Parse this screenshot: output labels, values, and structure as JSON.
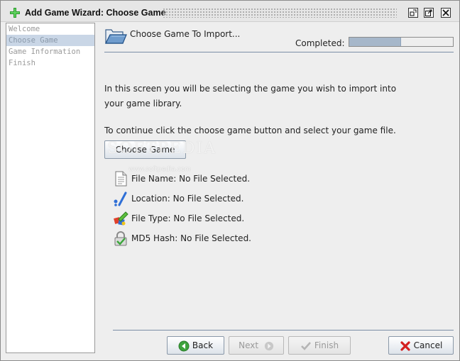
{
  "window": {
    "title": "Add Game Wizard: Choose Game",
    "controls": [
      "restore-icon",
      "maximize-icon",
      "close-icon"
    ]
  },
  "sidebar": {
    "steps": [
      {
        "label": "Welcome",
        "active": false
      },
      {
        "label": "Choose Game",
        "active": true
      },
      {
        "label": "Game Information",
        "active": false
      },
      {
        "label": "Finish",
        "active": false
      }
    ]
  },
  "header": {
    "title": "Choose Game To Import...",
    "completed_label": "Completed:",
    "progress_fraction": 0.5
  },
  "content": {
    "intro": "In this screen you will be selecting the game you wish to import into your game library.",
    "instruction": "To continue click the choose game button and select your game file.",
    "choose_button": "Choose Game",
    "watermark": "SOFTPEDIA",
    "watermark_url": "www.softpedia.com",
    "info": [
      {
        "label": "File Name:  No File Selected.",
        "icon": "file-icon"
      },
      {
        "label": "Location:  No File Selected.",
        "icon": "location-icon"
      },
      {
        "label": "File Type:  No File Selected.",
        "icon": "file-type-icon"
      },
      {
        "label": "MD5 Hash:  No File Selected.",
        "icon": "lock-icon"
      }
    ]
  },
  "footer": {
    "back": "Back",
    "next": "Next",
    "finish": "Finish",
    "cancel": "Cancel"
  },
  "colors": {
    "accent": "#7b8ea6",
    "active_step": "#c9d6e6",
    "progress_fill": "#a6b7ca",
    "back_icon": "#3da33d",
    "cancel_icon": "#d42020"
  }
}
